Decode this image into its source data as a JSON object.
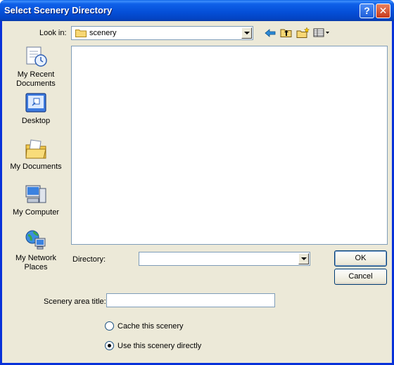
{
  "window": {
    "title": "Select Scenery Directory",
    "help_glyph": "?",
    "close_glyph": "✕"
  },
  "toolbar": {
    "look_in_label": "Look in:",
    "look_in_value": "scenery",
    "back_icon": "back-arrow-icon",
    "up_icon": "up-folder-icon",
    "new_folder_icon": "new-folder-icon",
    "views_icon": "views-menu-icon"
  },
  "places": [
    {
      "label_line1": "My Recent",
      "label_line2": "Documents",
      "icon": "recent-documents-icon"
    },
    {
      "label_line1": "Desktop",
      "label_line2": "",
      "icon": "desktop-icon"
    },
    {
      "label_line1": "My Documents",
      "label_line2": "",
      "icon": "my-documents-icon"
    },
    {
      "label_line1": "My Computer",
      "label_line2": "",
      "icon": "my-computer-icon"
    },
    {
      "label_line1": "My Network",
      "label_line2": "Places",
      "icon": "network-places-icon"
    }
  ],
  "directory": {
    "label": "Directory:",
    "value": ""
  },
  "buttons": {
    "ok": "OK",
    "cancel": "Cancel"
  },
  "scenery_title": {
    "label": "Scenery area title:",
    "value": ""
  },
  "options": {
    "cache_label": "Cache this scenery",
    "cache_checked": false,
    "direct_label": "Use this scenery directly",
    "direct_checked": true
  },
  "colors": {
    "title_bar": "#0550d9",
    "dialog_bg": "#ece9d8",
    "border": "#7f9db9"
  }
}
